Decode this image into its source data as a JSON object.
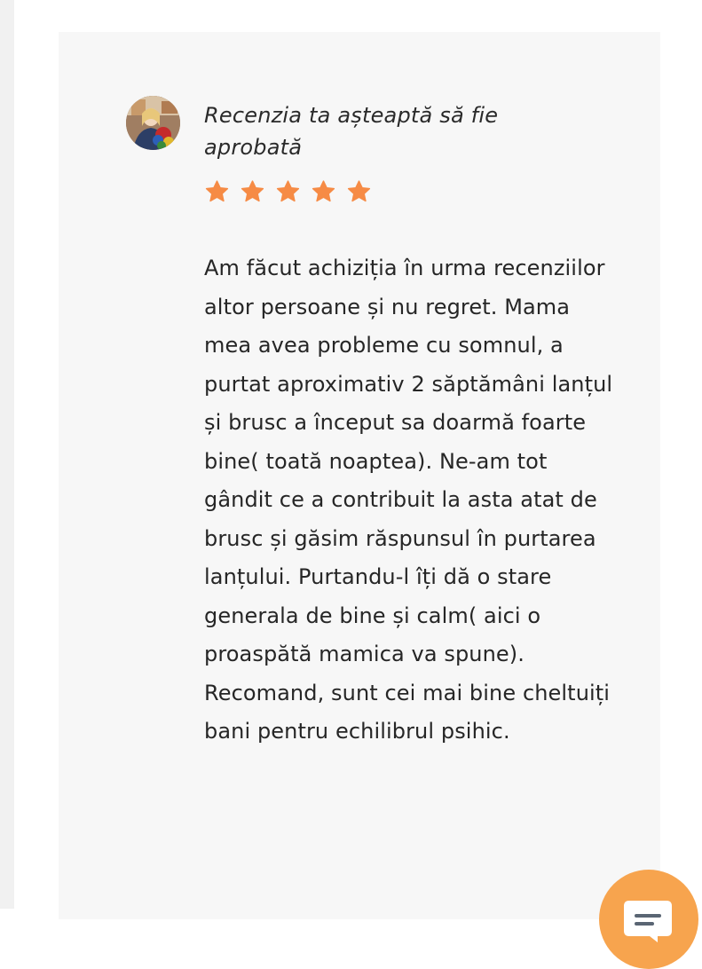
{
  "review": {
    "pending_message": "Recenzia ta așteaptă să fie aprobată",
    "rating": 5,
    "rating_max": 5,
    "star_color": "#f68b45",
    "body": "Am făcut achiziția în urma recenziilor altor persoane și nu regret. Mama mea avea probleme cu somnul, a purtat aproximativ 2 săptămâni lanțul și brusc a început sa doarmă foarte bine( toată noaptea). Ne-am tot gândit ce a contribuit la asta atat de brusc și găsim răspunsul în purtarea lanțului. Purtandu-l îți dă o stare generala de bine și calm( aici o proaspătă mamica va spune). Recomand, sunt cei mai bine cheltuiți bani pentru echilibrul psihic."
  },
  "chat": {
    "icon": "chat-bubble-icon",
    "color": "#f7a44e"
  }
}
